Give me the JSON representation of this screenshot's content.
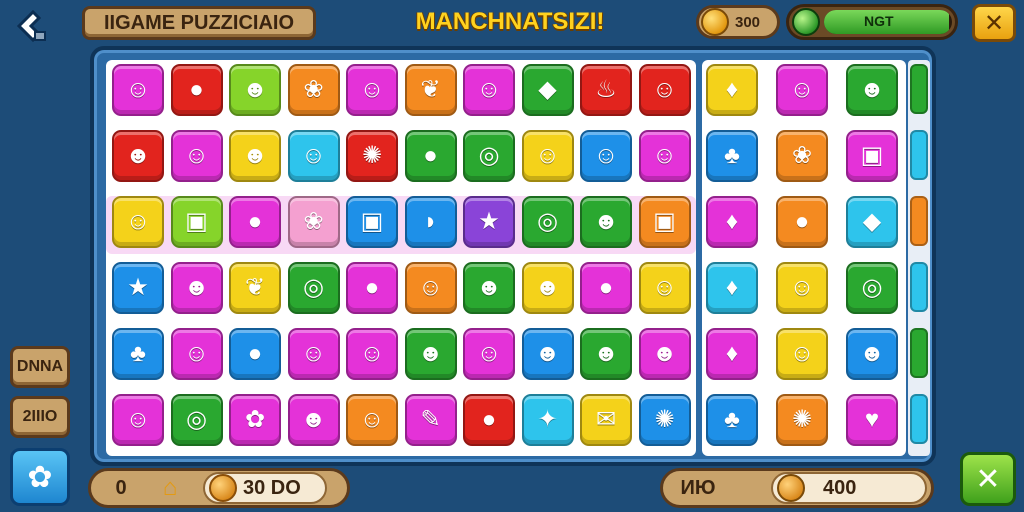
{
  "header": {
    "back_icon": "back-arrow-icon",
    "game_title": "IIGAME PUZZICIAIO",
    "banner": "MANCHNATSIZI!",
    "coins": "300",
    "progress_label": "NGT",
    "progress_fraction": 0.98,
    "close_icon": "close-icon",
    "close_label": "✕"
  },
  "side": {
    "top_label": "DNNA",
    "bottom_label": "2IIIO",
    "settings_icon": "gear-icon",
    "settings_label": "✿"
  },
  "footer": {
    "score": "0",
    "house_icon": "house-icon",
    "house_label": "⌂",
    "moves_value": "30 DO",
    "right_label": "ИЮ",
    "right_value": "400",
    "close_label": "✕"
  },
  "colors": {
    "magenta": "#e432d8",
    "red": "#e2241e",
    "lime": "#86d42a",
    "orange": "#f48a20",
    "green": "#2aa830",
    "purple": "#8a44d8",
    "yellow": "#f4d21a",
    "blue": "#1e90e8",
    "cyan": "#2ec4ec",
    "pink": "#f4a0d0"
  },
  "board": {
    "rows": [
      [
        "magenta:☺",
        "red:●",
        "lime:☻",
        "orange:❀",
        "magenta:☺",
        "orange:❦",
        "magenta:☺",
        "green:◆",
        "red:♨",
        "red:☺"
      ],
      [
        "red:☻",
        "magenta:☺",
        "yellow:☻",
        "cyan:☺",
        "red:✺",
        "green:●",
        "green:◎",
        "yellow:☺",
        "blue:☺",
        "magenta:☺"
      ],
      [
        "yellow:☺",
        "lime:▣",
        "magenta:●",
        "pink:❀",
        "blue:▣",
        "blue:◗",
        "purple:★",
        "green:◎",
        "green:☻",
        "orange:▣"
      ],
      [
        "blue:★",
        "magenta:☻",
        "yellow:❦",
        "green:◎",
        "magenta:●",
        "orange:☺",
        "green:☻",
        "yellow:☻",
        "magenta:●",
        "yellow:☺"
      ],
      [
        "blue:♣",
        "magenta:☺",
        "blue:●",
        "magenta:☺",
        "magenta:☺",
        "green:☻",
        "magenta:☺",
        "blue:☻",
        "green:☻",
        "magenta:☻"
      ],
      [
        "magenta:☺",
        "green:◎",
        "magenta:✿",
        "magenta:☻",
        "orange:☺",
        "magenta:✎",
        "red:●",
        "cyan:✦",
        "yellow:✉",
        "blue:✺"
      ]
    ],
    "right_rows": [
      [
        "yellow:♦",
        "magenta:☺",
        "green:☻"
      ],
      [
        "blue:♣",
        "orange:❀",
        "magenta:▣"
      ],
      [
        "magenta:♦",
        "orange:●",
        "cyan:◆"
      ],
      [
        "cyan:♦",
        "yellow:☺",
        "green:◎"
      ],
      [
        "magenta:♦",
        "yellow:☺",
        "blue:☻"
      ],
      [
        "blue:♣",
        "orange:✺",
        "magenta:♥"
      ]
    ],
    "edge_colors": [
      "green",
      "cyan",
      "orange",
      "cyan",
      "green",
      "cyan"
    ]
  }
}
